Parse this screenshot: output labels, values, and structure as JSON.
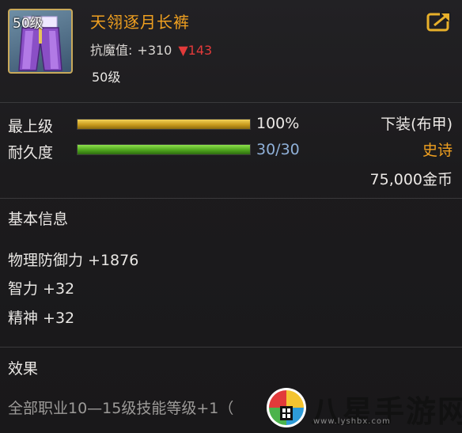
{
  "item": {
    "level_badge": "50级",
    "name": "天翎逐月长裤",
    "resist_label": "抗魔值:",
    "resist_plus": "+310",
    "resist_down": "▼143",
    "required_level": "50级",
    "icon": "purple-pants-icon"
  },
  "share": {
    "icon": "share-icon"
  },
  "stats": {
    "max_level_label": "最上级",
    "max_level_value": "100%",
    "max_level_fraction": 1.0,
    "durability_label": "耐久度",
    "durability_value": "30/30",
    "durability_fraction": 1.0,
    "slot": "下装(布甲)",
    "rarity": "史诗",
    "price": "75,000金币"
  },
  "basic": {
    "title": "基本信息",
    "attrs": [
      "物理防御力 +1876",
      "智力 +32",
      "精神 +32"
    ]
  },
  "effect": {
    "title": "效果",
    "text": "全部职业10—15级技能等级+1（"
  },
  "watermark": {
    "text": "八星手游网",
    "url": "www.lyshbx.com"
  },
  "colors": {
    "rarity": "#f0a020",
    "resist_down": "#e23a3a",
    "durability_value": "#8fb0d8",
    "bar_gold": "#f3d35a",
    "bar_green": "#8ee04c"
  }
}
